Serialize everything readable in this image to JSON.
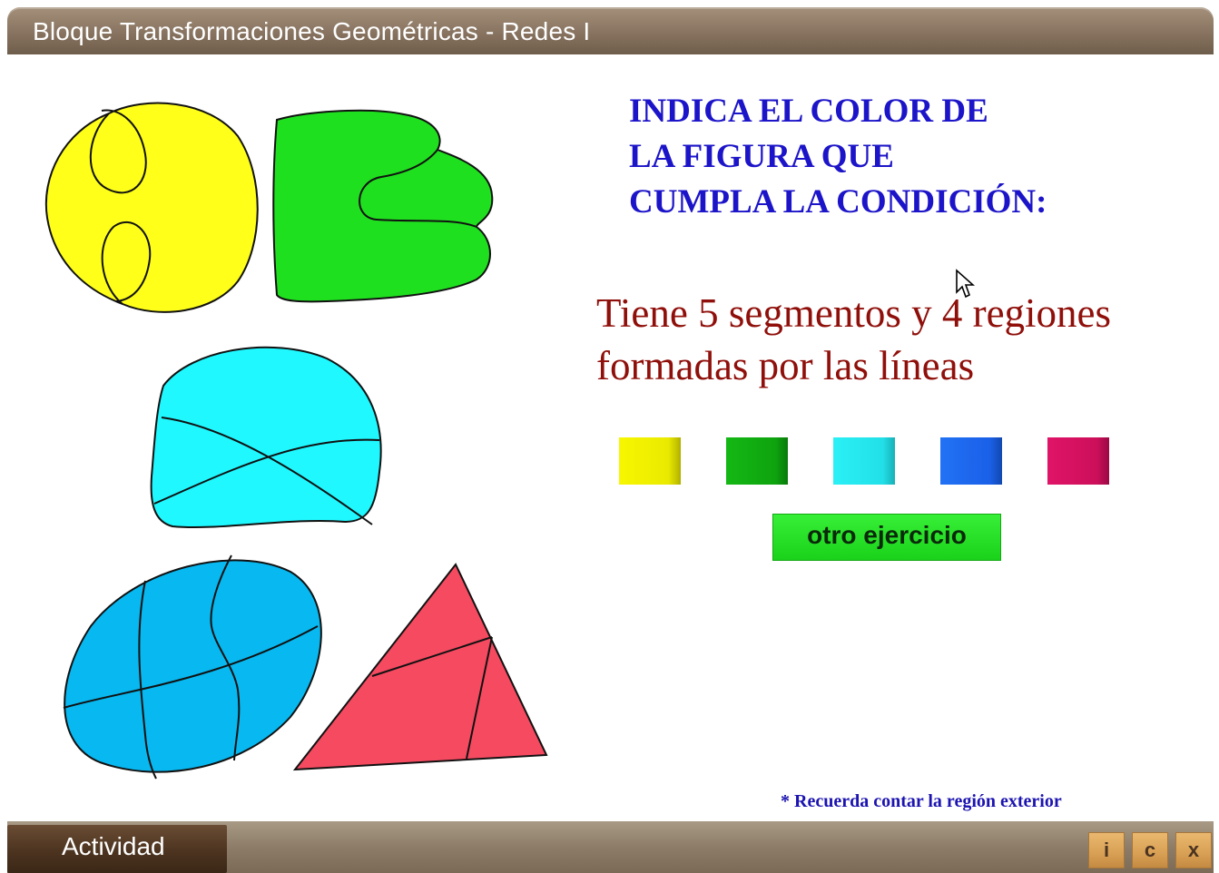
{
  "window": {
    "title": "Bloque Transformaciones Geométricas - Redes I"
  },
  "instruction": {
    "lines": [
      "INDICA EL COLOR DE",
      "LA  FIGURA  QUE",
      "CUMPLA LA CONDICIÓN:"
    ]
  },
  "condition": {
    "lines": [
      "Tiene 5  segmentos y 4 regiones",
      "formadas por las líneas"
    ]
  },
  "figures": [
    {
      "name": "yellow-figure",
      "color": "#ffff1a"
    },
    {
      "name": "green-figure",
      "color": "#1fe01f"
    },
    {
      "name": "cyan-figure",
      "color": "#1ff8ff"
    },
    {
      "name": "blue-figure",
      "color": "#08b8f0"
    },
    {
      "name": "red-figure",
      "color": "#f54a60"
    }
  ],
  "swatches": [
    {
      "name": "yellow",
      "color": "#f5f500"
    },
    {
      "name": "green",
      "color": "#10b010"
    },
    {
      "name": "cyan",
      "color": "#22eaf0"
    },
    {
      "name": "blue",
      "color": "#1a66f0"
    },
    {
      "name": "magenta",
      "color": "#d81060"
    }
  ],
  "buttons": {
    "next_exercise": "otro ejercicio"
  },
  "note": "* Recuerda contar la región exterior",
  "footer": {
    "activity_label": "Actividad",
    "info_label": "i",
    "credits_label": "c",
    "close_label": "x"
  }
}
